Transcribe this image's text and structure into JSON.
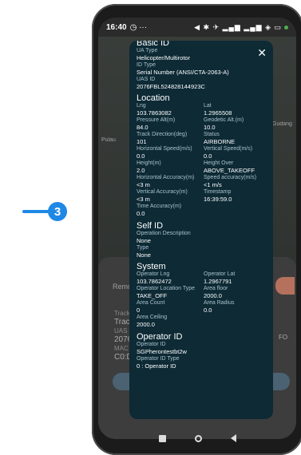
{
  "step": {
    "number": "3"
  },
  "status_bar": {
    "time": "16:40",
    "extra": "◷ ···",
    "icons": "◀ ✱ ✈ ▂▄▆ ▂▄▆ ◈ ▭"
  },
  "background": {
    "tracking": "Remo",
    "left_lines": [
      "Track",
      "Track",
      "UAS ID",
      "2076",
      "MAC A",
      "C0:DE"
    ],
    "right_label": "FO",
    "map_label": "Pulau",
    "map_label2": "Gudang"
  },
  "dialog": {
    "close_label": "✕",
    "basic_id": {
      "title": "Basic ID",
      "ua_type_label": "UA Type",
      "ua_type": "Helicopter/Multirotor",
      "id_type_label": "ID Type",
      "id_type": "Serial Number (ANSI/CTA-2063-A)",
      "uas_id_label": "UAS ID",
      "uas_id": "2076FBL524828144923C"
    },
    "location": {
      "title": "Location",
      "fields": [
        {
          "label": "Lng",
          "value": "103.7863082"
        },
        {
          "label": "Lat",
          "value": "1.2965508"
        },
        {
          "label": "Pressure Alt(m)",
          "value": "84.0"
        },
        {
          "label": "Geodetic Alt.(m)",
          "value": "10.0"
        },
        {
          "label": "Track Direction(deg)",
          "value": "101"
        },
        {
          "label": "Status",
          "value": "AIRBORNE"
        },
        {
          "label": "Horizontal Speed(m/s)",
          "value": "0.0"
        },
        {
          "label": "Vertical Speed(m/s)",
          "value": "0.0"
        },
        {
          "label": "Height(m)",
          "value": "2.0"
        },
        {
          "label": "Height Over",
          "value": "ABOVE_TAKEOFF"
        },
        {
          "label": "Horizontal Accuracy(m)",
          "value": "<3 m"
        },
        {
          "label": "Speed accuracy(m/s)",
          "value": "<1 m/s"
        },
        {
          "label": "Vertical Accuracy(m)",
          "value": "<3 m"
        },
        {
          "label": "Timestamp",
          "value": "16:39:59.0"
        },
        {
          "label": "Time Accuracy(m)",
          "value": "0.0"
        }
      ]
    },
    "self_id": {
      "title": "Self ID",
      "desc_label": "Operation Description",
      "desc": "None",
      "type_label": "Type",
      "type": "None"
    },
    "system": {
      "title": "System",
      "fields": [
        {
          "label": "Operator Lng",
          "value": "103.7862472"
        },
        {
          "label": "Operator Lat",
          "value": "1.2967791"
        },
        {
          "label": "Operator Location Type",
          "value": "TAKE_OFF"
        },
        {
          "label": "Area floor",
          "value": "2000.0"
        },
        {
          "label": "Area Count",
          "value": "0"
        },
        {
          "label": "Area Radius",
          "value": "0.0"
        },
        {
          "label": "Area Ceiling",
          "value": "2000.0"
        }
      ]
    },
    "operator_id": {
      "title": "Operator ID",
      "id_label": "Operator ID",
      "id": "SGPherontestbt2w",
      "type_label": "Operator ID Type",
      "type": "0 : Operator ID"
    }
  },
  "colors": {
    "dialog_bg": "#0d2a35",
    "accent": "#1e88e5",
    "label": "#a9c2cb"
  }
}
